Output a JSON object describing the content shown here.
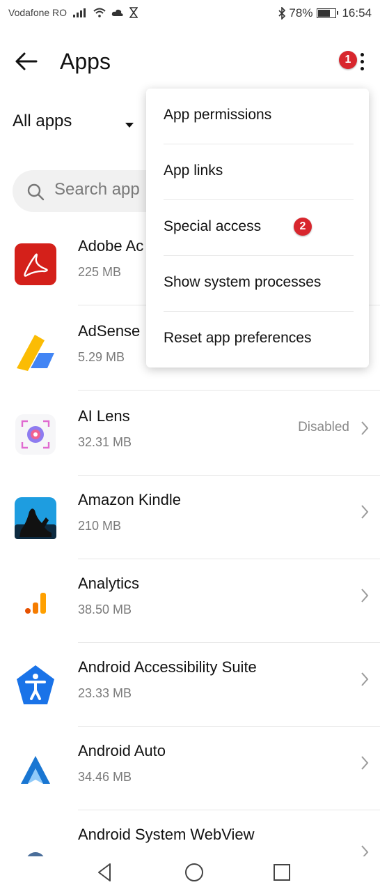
{
  "status": {
    "carrier": "Vodafone RO",
    "battery": "78%",
    "battery_level": 0.78,
    "time": "16:54"
  },
  "header": {
    "title": "Apps",
    "badge_1": "1"
  },
  "filter": {
    "label": "All apps"
  },
  "search": {
    "placeholder": "Search app"
  },
  "menu": {
    "items": [
      "App permissions",
      "App links",
      "Special access",
      "Show system processes",
      "Reset app preferences"
    ],
    "badge_2": "2"
  },
  "apps": [
    {
      "name": "Adobe Ac",
      "size": "225 MB",
      "status": "",
      "icon": "adobe-acrobat-icon"
    },
    {
      "name": "AdSense",
      "size": "5.29 MB",
      "status": "",
      "icon": "adsense-icon"
    },
    {
      "name": "AI Lens",
      "size": "32.31 MB",
      "status": "Disabled",
      "icon": "ai-lens-icon"
    },
    {
      "name": "Amazon Kindle",
      "size": "210 MB",
      "status": "",
      "icon": "kindle-icon"
    },
    {
      "name": "Analytics",
      "size": "38.50 MB",
      "status": "",
      "icon": "analytics-icon"
    },
    {
      "name": "Android Accessibility Suite",
      "size": "23.33 MB",
      "status": "",
      "icon": "accessibility-icon"
    },
    {
      "name": "Android Auto",
      "size": "34.46 MB",
      "status": "",
      "icon": "android-auto-icon"
    },
    {
      "name": "Android System WebView",
      "size": "",
      "status": "",
      "icon": "webview-icon"
    }
  ],
  "colors": {
    "badge": "#d8262d",
    "adobe": "#d4201a",
    "accessibility": "#1a73e8",
    "analytics_orange": "#f57c00"
  }
}
